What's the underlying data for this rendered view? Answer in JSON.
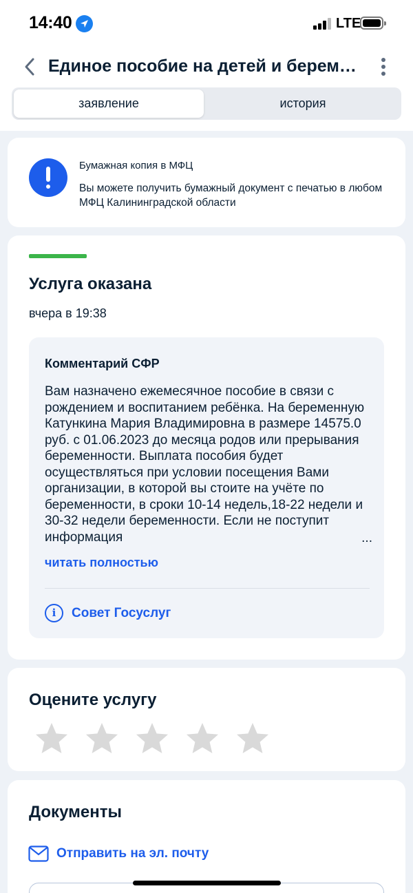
{
  "status_bar": {
    "time": "14:40",
    "network": "LTE",
    "location_icon": "location-arrow-icon",
    "signal_icon": "signal-bars-icon",
    "battery_icon": "battery-icon"
  },
  "header": {
    "title": "Единое пособие на детей и беременность",
    "back_icon": "chevron-left-icon",
    "more_icon": "more-vertical-icon"
  },
  "tabs": [
    {
      "label": "заявление",
      "active": true
    },
    {
      "label": "история",
      "active": false
    }
  ],
  "notice": {
    "icon": "exclamation-icon",
    "title": "Бумажная копия в МФЦ",
    "text": "Вы можете получить бумажный документ с печатью в любом МФЦ Калининградской области"
  },
  "status": {
    "title": "Услуга оказана",
    "time": "вчера в 19:38",
    "comment": {
      "title": "Комментарий СФР",
      "text": "Вам назначено ежемесячное пособие в связи с рождением и воспитанием ребёнка. На беременную Катункина Мария Владимировна в размере 14575.0 руб. с 01.06.2023 до месяца родов или прерывания беременности. Выплата пособия будет осуществляться при условии посещения Вами организации, в которой вы стоите на учёте по беременности, в сроки 10-14 недель,18-22 недели и 30-32 недели беременности. Если не поступит информация",
      "read_more": "читать полностью",
      "tip_label": "Совет Госуслуг",
      "tip_icon": "info-icon"
    }
  },
  "rating": {
    "title": "Оцените услугу",
    "stars_total": 5,
    "stars_selected": 0,
    "star_icon": "star-icon",
    "star_color": "#d9d9d9"
  },
  "documents": {
    "title": "Документы",
    "send_email_label": "Отправить на эл. почту",
    "mail_icon": "mail-icon"
  },
  "colors": {
    "accent": "#1d5deb",
    "success": "#3bb54a",
    "background": "#eef2f7"
  }
}
